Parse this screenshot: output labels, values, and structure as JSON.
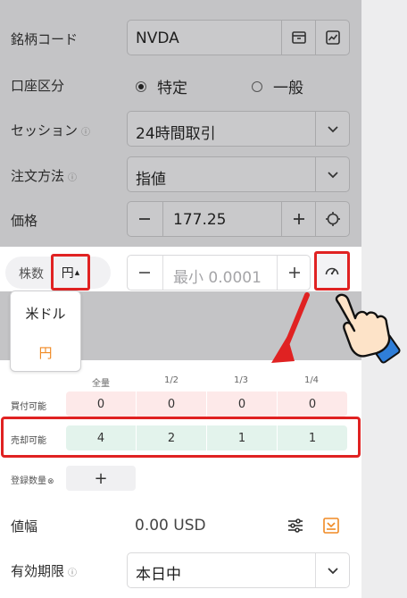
{
  "form": {
    "symbol": {
      "label": "銘柄コード",
      "value": "NVDA"
    },
    "account": {
      "label": "口座区分",
      "options": [
        "特定",
        "一般"
      ],
      "selected": "特定"
    },
    "session": {
      "label": "セッション",
      "value": "24時間取引"
    },
    "order_method": {
      "label": "注文方法",
      "value": "指値"
    },
    "price": {
      "label": "価格",
      "value": "177.25"
    },
    "shares": {
      "label": "株数",
      "unit": "円",
      "placeholder": "最小 0.0001"
    },
    "unit_menu": {
      "options": [
        "米ドル",
        "円"
      ],
      "selected": "円"
    }
  },
  "availability": {
    "columns": [
      "全量",
      "1/2",
      "1/3",
      "1/4"
    ],
    "rows": [
      {
        "label": "買付可能",
        "values": [
          "0",
          "0",
          "0",
          "0"
        ]
      },
      {
        "label": "売却可能",
        "values": [
          "4",
          "2",
          "1",
          "1"
        ]
      }
    ],
    "register_label": "登録数量"
  },
  "price_range": {
    "label": "値幅",
    "value": "0.00 USD"
  },
  "expiry": {
    "label": "有効期限",
    "value": "本日中"
  },
  "colors": {
    "highlight": "#e02222",
    "accent_orange": "#f08a24",
    "buy_bg": "#fde9e9",
    "sell_bg": "#e3f3ec"
  },
  "icons": [
    "archive-icon",
    "chart-icon",
    "chevron-down-icon",
    "minus-icon",
    "plus-icon",
    "crosshair-icon",
    "gauge-icon",
    "info-icon",
    "settings-sliders-icon",
    "download-icon",
    "pointing-hand-icon",
    "arrow-icon"
  ]
}
